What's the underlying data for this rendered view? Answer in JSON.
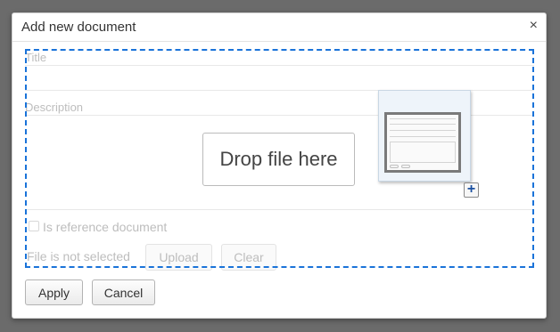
{
  "dialog": {
    "title": "Add new document",
    "close_glyph": "×"
  },
  "form": {
    "title_label": "Title",
    "title_value": "",
    "description_label": "Description",
    "description_value": "",
    "drop_zone_text": "Drop file here",
    "thumbnail_icon": "document-preview-icon",
    "add_button_glyph": "+",
    "reference_checkbox_label": "Is reference document",
    "reference_checkbox_checked": false,
    "file_status": "File is not selected",
    "upload_label": "Upload",
    "clear_label": "Clear"
  },
  "footer": {
    "apply_label": "Apply",
    "cancel_label": "Cancel"
  },
  "colors": {
    "drop_outline": "#1a73d9",
    "backdrop": "#6b6b6b"
  }
}
